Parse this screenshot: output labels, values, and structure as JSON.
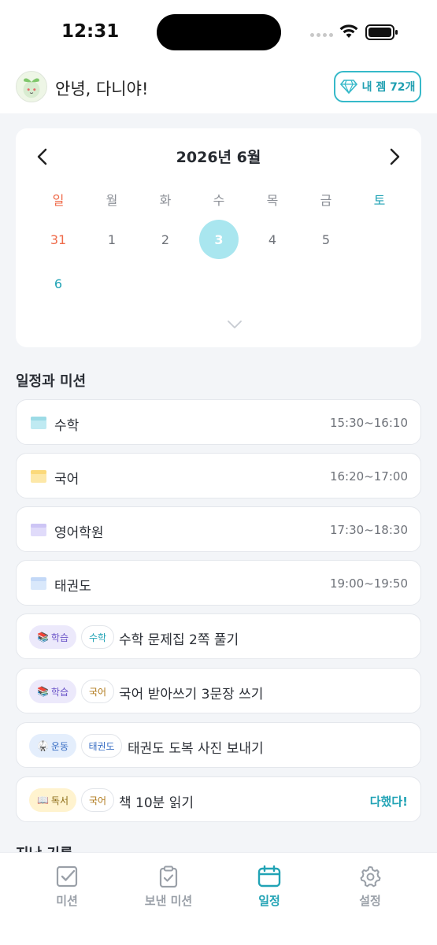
{
  "status": {
    "time": "12:31"
  },
  "header": {
    "greeting": "안녕, 다니야!",
    "gem_label": "내 젬 72개"
  },
  "calendar": {
    "title": "2026년 6월",
    "weekdays": [
      "일",
      "월",
      "화",
      "수",
      "목",
      "금",
      "토"
    ],
    "row1": [
      "31",
      "1",
      "2",
      "3",
      "4",
      "5"
    ],
    "row2": [
      "6"
    ],
    "selected": "3"
  },
  "section": {
    "title": "일정과 미션"
  },
  "schedules": [
    {
      "title": "수학",
      "time": "15:30~16:10",
      "color": "#bfeaf2"
    },
    {
      "title": "국어",
      "time": "16:20~17:00",
      "color": "#fde8a8"
    },
    {
      "title": "영어학원",
      "time": "17:30~18:30",
      "color": "#e0dbfa"
    },
    {
      "title": "태권도",
      "time": "19:00~19:50",
      "color": "#d9e8fb"
    }
  ],
  "missions": [
    {
      "category": "학습",
      "category_icon": "books-icon",
      "subject": "수학",
      "title": "수학 문제집 2쪽 풀기",
      "status": ""
    },
    {
      "category": "학습",
      "category_icon": "books-icon",
      "subject": "국어",
      "title": "국어 받아쓰기 3문장 쓰기",
      "status": ""
    },
    {
      "category": "운동",
      "category_icon": "uniform-icon",
      "subject": "태권도",
      "title": "태권도 도복 사진 보내기",
      "status": ""
    },
    {
      "category": "독서",
      "category_icon": "open-book-icon",
      "subject": "국어",
      "title": "책 10분 읽기",
      "status": "다했다!"
    }
  ],
  "record_section": {
    "title": "지난 기록"
  },
  "nav": {
    "items": [
      "미션",
      "보낸 미션",
      "일정",
      "설정"
    ],
    "active": "일정"
  },
  "colors": {
    "accent": "#21a3b5",
    "selected_day": "#a9e6ef",
    "sunday": "#ef6b4a"
  }
}
